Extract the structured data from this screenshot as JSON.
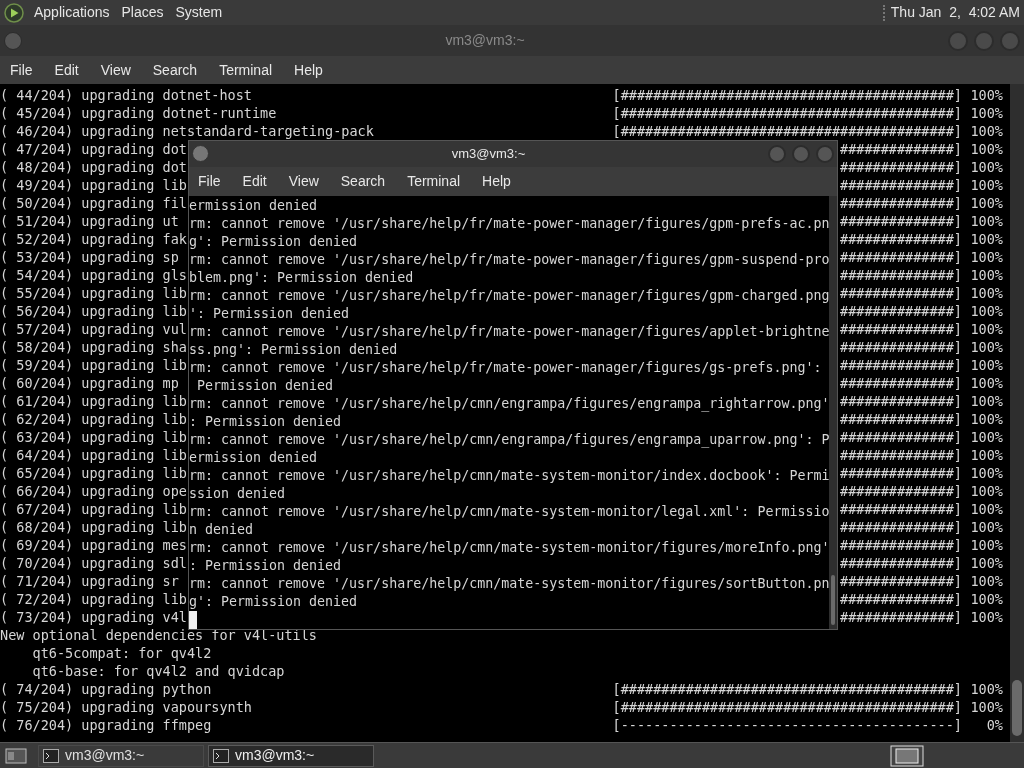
{
  "top_panel": {
    "menus": [
      "Applications",
      "Places",
      "System"
    ],
    "clock": "Thu Jan  2,  4:02 AM"
  },
  "back_terminal": {
    "title": "vm3@vm3:~",
    "menu": [
      "File",
      "Edit",
      "View",
      "Search",
      "Terminal",
      "Help"
    ],
    "lines": [
      {
        "kind": "progress",
        "text": "( 44/204) upgrading dotnet-host",
        "bar": "[#########################################]",
        "percent": "100%"
      },
      {
        "kind": "progress",
        "text": "( 45/204) upgrading dotnet-runtime",
        "bar": "[#########################################]",
        "percent": "100%"
      },
      {
        "kind": "progress",
        "text": "( 46/204) upgrading netstandard-targeting-pack",
        "bar": "[#########################################]",
        "percent": "100%"
      },
      {
        "kind": "progress",
        "text": "( 47/204) upgrading dot",
        "bar": "##############]",
        "percent": "100%"
      },
      {
        "kind": "progress",
        "text": "( 48/204) upgrading dot",
        "bar": "##############]",
        "percent": "100%"
      },
      {
        "kind": "progress",
        "text": "( 49/204) upgrading lib",
        "bar": "##############]",
        "percent": "100%"
      },
      {
        "kind": "progress",
        "text": "( 50/204) upgrading fil",
        "bar": "##############]",
        "percent": "100%"
      },
      {
        "kind": "progress",
        "text": "( 51/204) upgrading ut",
        "bar": "##############]",
        "percent": "100%"
      },
      {
        "kind": "progress",
        "text": "( 52/204) upgrading fak",
        "bar": "##############]",
        "percent": "100%"
      },
      {
        "kind": "progress",
        "text": "( 53/204) upgrading sp",
        "bar": "##############]",
        "percent": "100%"
      },
      {
        "kind": "progress",
        "text": "( 54/204) upgrading gls",
        "bar": "##############]",
        "percent": "100%"
      },
      {
        "kind": "progress",
        "text": "( 55/204) upgrading lib",
        "bar": "##############]",
        "percent": "100%"
      },
      {
        "kind": "progress",
        "text": "( 56/204) upgrading lib",
        "bar": "##############]",
        "percent": "100%"
      },
      {
        "kind": "progress",
        "text": "( 57/204) upgrading vul",
        "bar": "##############]",
        "percent": "100%"
      },
      {
        "kind": "progress",
        "text": "( 58/204) upgrading sha",
        "bar": "##############]",
        "percent": "100%"
      },
      {
        "kind": "progress",
        "text": "( 59/204) upgrading lib",
        "bar": "##############]",
        "percent": "100%"
      },
      {
        "kind": "progress",
        "text": "( 60/204) upgrading mp",
        "bar": "##############]",
        "percent": "100%"
      },
      {
        "kind": "progress",
        "text": "( 61/204) upgrading lib",
        "bar": "##############]",
        "percent": "100%"
      },
      {
        "kind": "progress",
        "text": "( 62/204) upgrading lib",
        "bar": "##############]",
        "percent": "100%"
      },
      {
        "kind": "progress",
        "text": "( 63/204) upgrading lib",
        "bar": "##############]",
        "percent": "100%"
      },
      {
        "kind": "progress",
        "text": "( 64/204) upgrading lib",
        "bar": "##############]",
        "percent": "100%"
      },
      {
        "kind": "progress",
        "text": "( 65/204) upgrading lib",
        "bar": "##############]",
        "percent": "100%"
      },
      {
        "kind": "progress",
        "text": "( 66/204) upgrading ope",
        "bar": "##############]",
        "percent": "100%"
      },
      {
        "kind": "progress",
        "text": "( 67/204) upgrading lib",
        "bar": "##############]",
        "percent": "100%"
      },
      {
        "kind": "progress",
        "text": "( 68/204) upgrading lib",
        "bar": "##############]",
        "percent": "100%"
      },
      {
        "kind": "progress",
        "text": "( 69/204) upgrading mes",
        "bar": "##############]",
        "percent": "100%"
      },
      {
        "kind": "progress",
        "text": "( 70/204) upgrading sdl",
        "bar": "##############]",
        "percent": "100%"
      },
      {
        "kind": "progress",
        "text": "( 71/204) upgrading sr",
        "bar": "##############]",
        "percent": "100%"
      },
      {
        "kind": "progress",
        "text": "( 72/204) upgrading lib",
        "bar": "##############]",
        "percent": "100%"
      },
      {
        "kind": "progress",
        "text": "( 73/204) upgrading v4l",
        "bar": "##############]",
        "percent": "100%"
      },
      {
        "kind": "plain",
        "text": "New optional dependencies for v4l-utils"
      },
      {
        "kind": "plain",
        "text": "    qt6-5compat: for qv4l2"
      },
      {
        "kind": "plain",
        "text": "    qt6-base: for qv4l2 and qvidcap"
      },
      {
        "kind": "progress",
        "text": "( 74/204) upgrading python",
        "bar": "[#########################################]",
        "percent": "100%"
      },
      {
        "kind": "progress",
        "text": "( 75/204) upgrading vapoursynth",
        "bar": "[#########################################]",
        "percent": "100%"
      },
      {
        "kind": "progress",
        "text": "( 76/204) upgrading ffmpeg",
        "bar": "[-----------------------------------------]",
        "percent": "0%"
      }
    ]
  },
  "front_terminal": {
    "title": "vm3@vm3:~",
    "menu": [
      "File",
      "Edit",
      "View",
      "Search",
      "Terminal",
      "Help"
    ],
    "lines": [
      "ermission denied",
      "rm: cannot remove '/usr/share/help/fr/mate-power-manager/figures/gpm-prefs-ac.pn",
      "g': Permission denied",
      "rm: cannot remove '/usr/share/help/fr/mate-power-manager/figures/gpm-suspend-pro",
      "blem.png': Permission denied",
      "rm: cannot remove '/usr/share/help/fr/mate-power-manager/figures/gpm-charged.png",
      "': Permission denied",
      "rm: cannot remove '/usr/share/help/fr/mate-power-manager/figures/applet-brightne",
      "ss.png': Permission denied",
      "rm: cannot remove '/usr/share/help/fr/mate-power-manager/figures/gs-prefs.png':",
      " Permission denied",
      "rm: cannot remove '/usr/share/help/cmn/engrampa/figures/engrampa_rightarrow.png'",
      ": Permission denied",
      "rm: cannot remove '/usr/share/help/cmn/engrampa/figures/engrampa_uparrow.png': P",
      "ermission denied",
      "rm: cannot remove '/usr/share/help/cmn/mate-system-monitor/index.docbook': Permi",
      "ssion denied",
      "rm: cannot remove '/usr/share/help/cmn/mate-system-monitor/legal.xml': Permissio",
      "n denied",
      "rm: cannot remove '/usr/share/help/cmn/mate-system-monitor/figures/moreInfo.png'",
      ": Permission denied",
      "rm: cannot remove '/usr/share/help/cmn/mate-system-monitor/figures/sortButton.pn",
      "g': Permission denied"
    ]
  },
  "taskbar": {
    "tasks": [
      {
        "label": "vm3@vm3:~",
        "selected": false
      },
      {
        "label": "vm3@vm3:~",
        "selected": true
      }
    ]
  }
}
